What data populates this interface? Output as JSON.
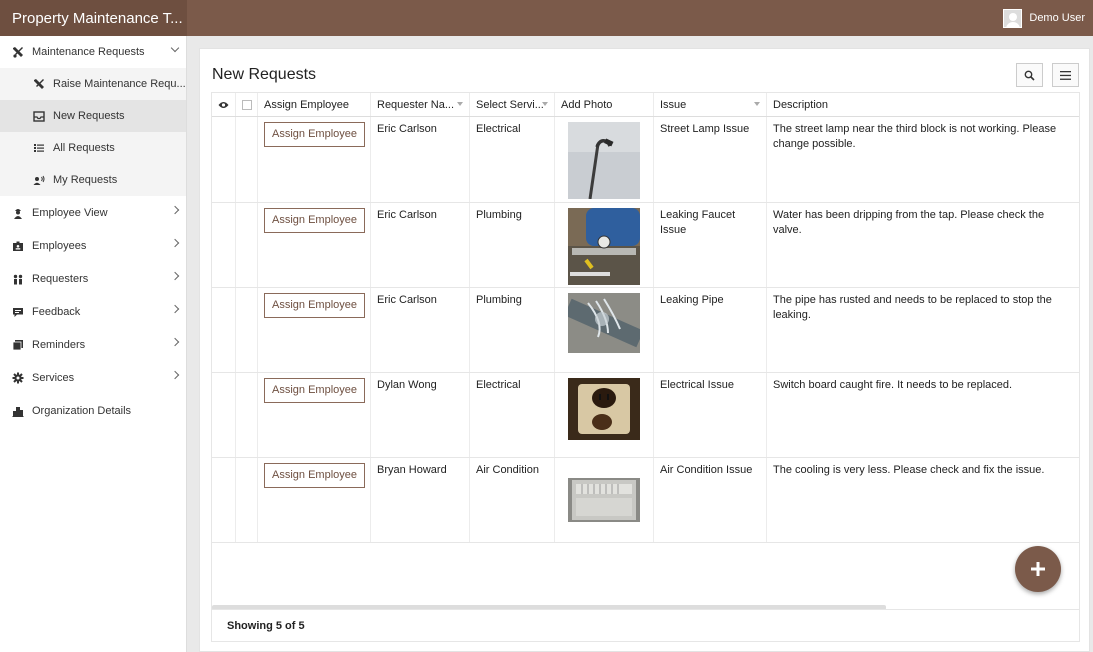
{
  "app": {
    "title": "Property Maintenance T...",
    "user_name": "Demo User"
  },
  "sidebar": {
    "items": [
      {
        "label": "Maintenance Requests",
        "icon": "tools-icon",
        "expanded": true
      },
      {
        "label": "Employee View",
        "icon": "worker-icon"
      },
      {
        "label": "Employees",
        "icon": "id-card-icon"
      },
      {
        "label": "Requesters",
        "icon": "people-icon"
      },
      {
        "label": "Feedback",
        "icon": "chat-icon"
      },
      {
        "label": "Reminders",
        "icon": "notes-icon"
      },
      {
        "label": "Services",
        "icon": "gear-icon"
      },
      {
        "label": "Organization Details",
        "icon": "building-icon"
      }
    ],
    "subitems": [
      {
        "label": "Raise Maintenance Requ...",
        "icon": "tools-icon"
      },
      {
        "label": "New Requests",
        "icon": "inbox-icon",
        "active": true
      },
      {
        "label": "All Requests",
        "icon": "list-icon"
      },
      {
        "label": "My Requests",
        "icon": "user-voice-icon"
      }
    ]
  },
  "main": {
    "title": "New Requests",
    "columns": [
      "Assign Employee",
      "Requester Na...",
      "Select Servi...",
      "Add Photo",
      "Issue",
      "Description"
    ],
    "assign_label": "Assign Employee",
    "rows": [
      {
        "requester": "Eric Carlson",
        "service": "Electrical",
        "issue": "Street Lamp Issue",
        "description": "The street lamp near the third block is not working. Please change possible.",
        "photo": "street-lamp-photo"
      },
      {
        "requester": "Eric Carlson",
        "service": "Plumbing",
        "issue": "Leaking Faucet Issue",
        "description": "Water has been dripping from the tap. Please check the valve.",
        "photo": "faucet-valve-photo"
      },
      {
        "requester": "Eric Carlson",
        "service": "Plumbing",
        "issue": "Leaking Pipe",
        "description": "The pipe has rusted and needs to be replaced to stop the leaking.",
        "photo": "leaking-pipe-photo"
      },
      {
        "requester": "Dylan Wong",
        "service": "Electrical",
        "issue": "Electrical Issue",
        "description": "Switch board caught fire. It needs to be replaced.",
        "photo": "burnt-socket-photo"
      },
      {
        "requester": "Bryan Howard",
        "service": "Air Condition",
        "issue": "Air Condition Issue",
        "description": "The cooling is very less. Please check and fix the issue.",
        "photo": "air-conditioner-photo"
      }
    ],
    "footer": "Showing 5 of 5"
  },
  "colors": {
    "brand": "#7b5a4a",
    "brand_dark": "#6e4f40"
  }
}
